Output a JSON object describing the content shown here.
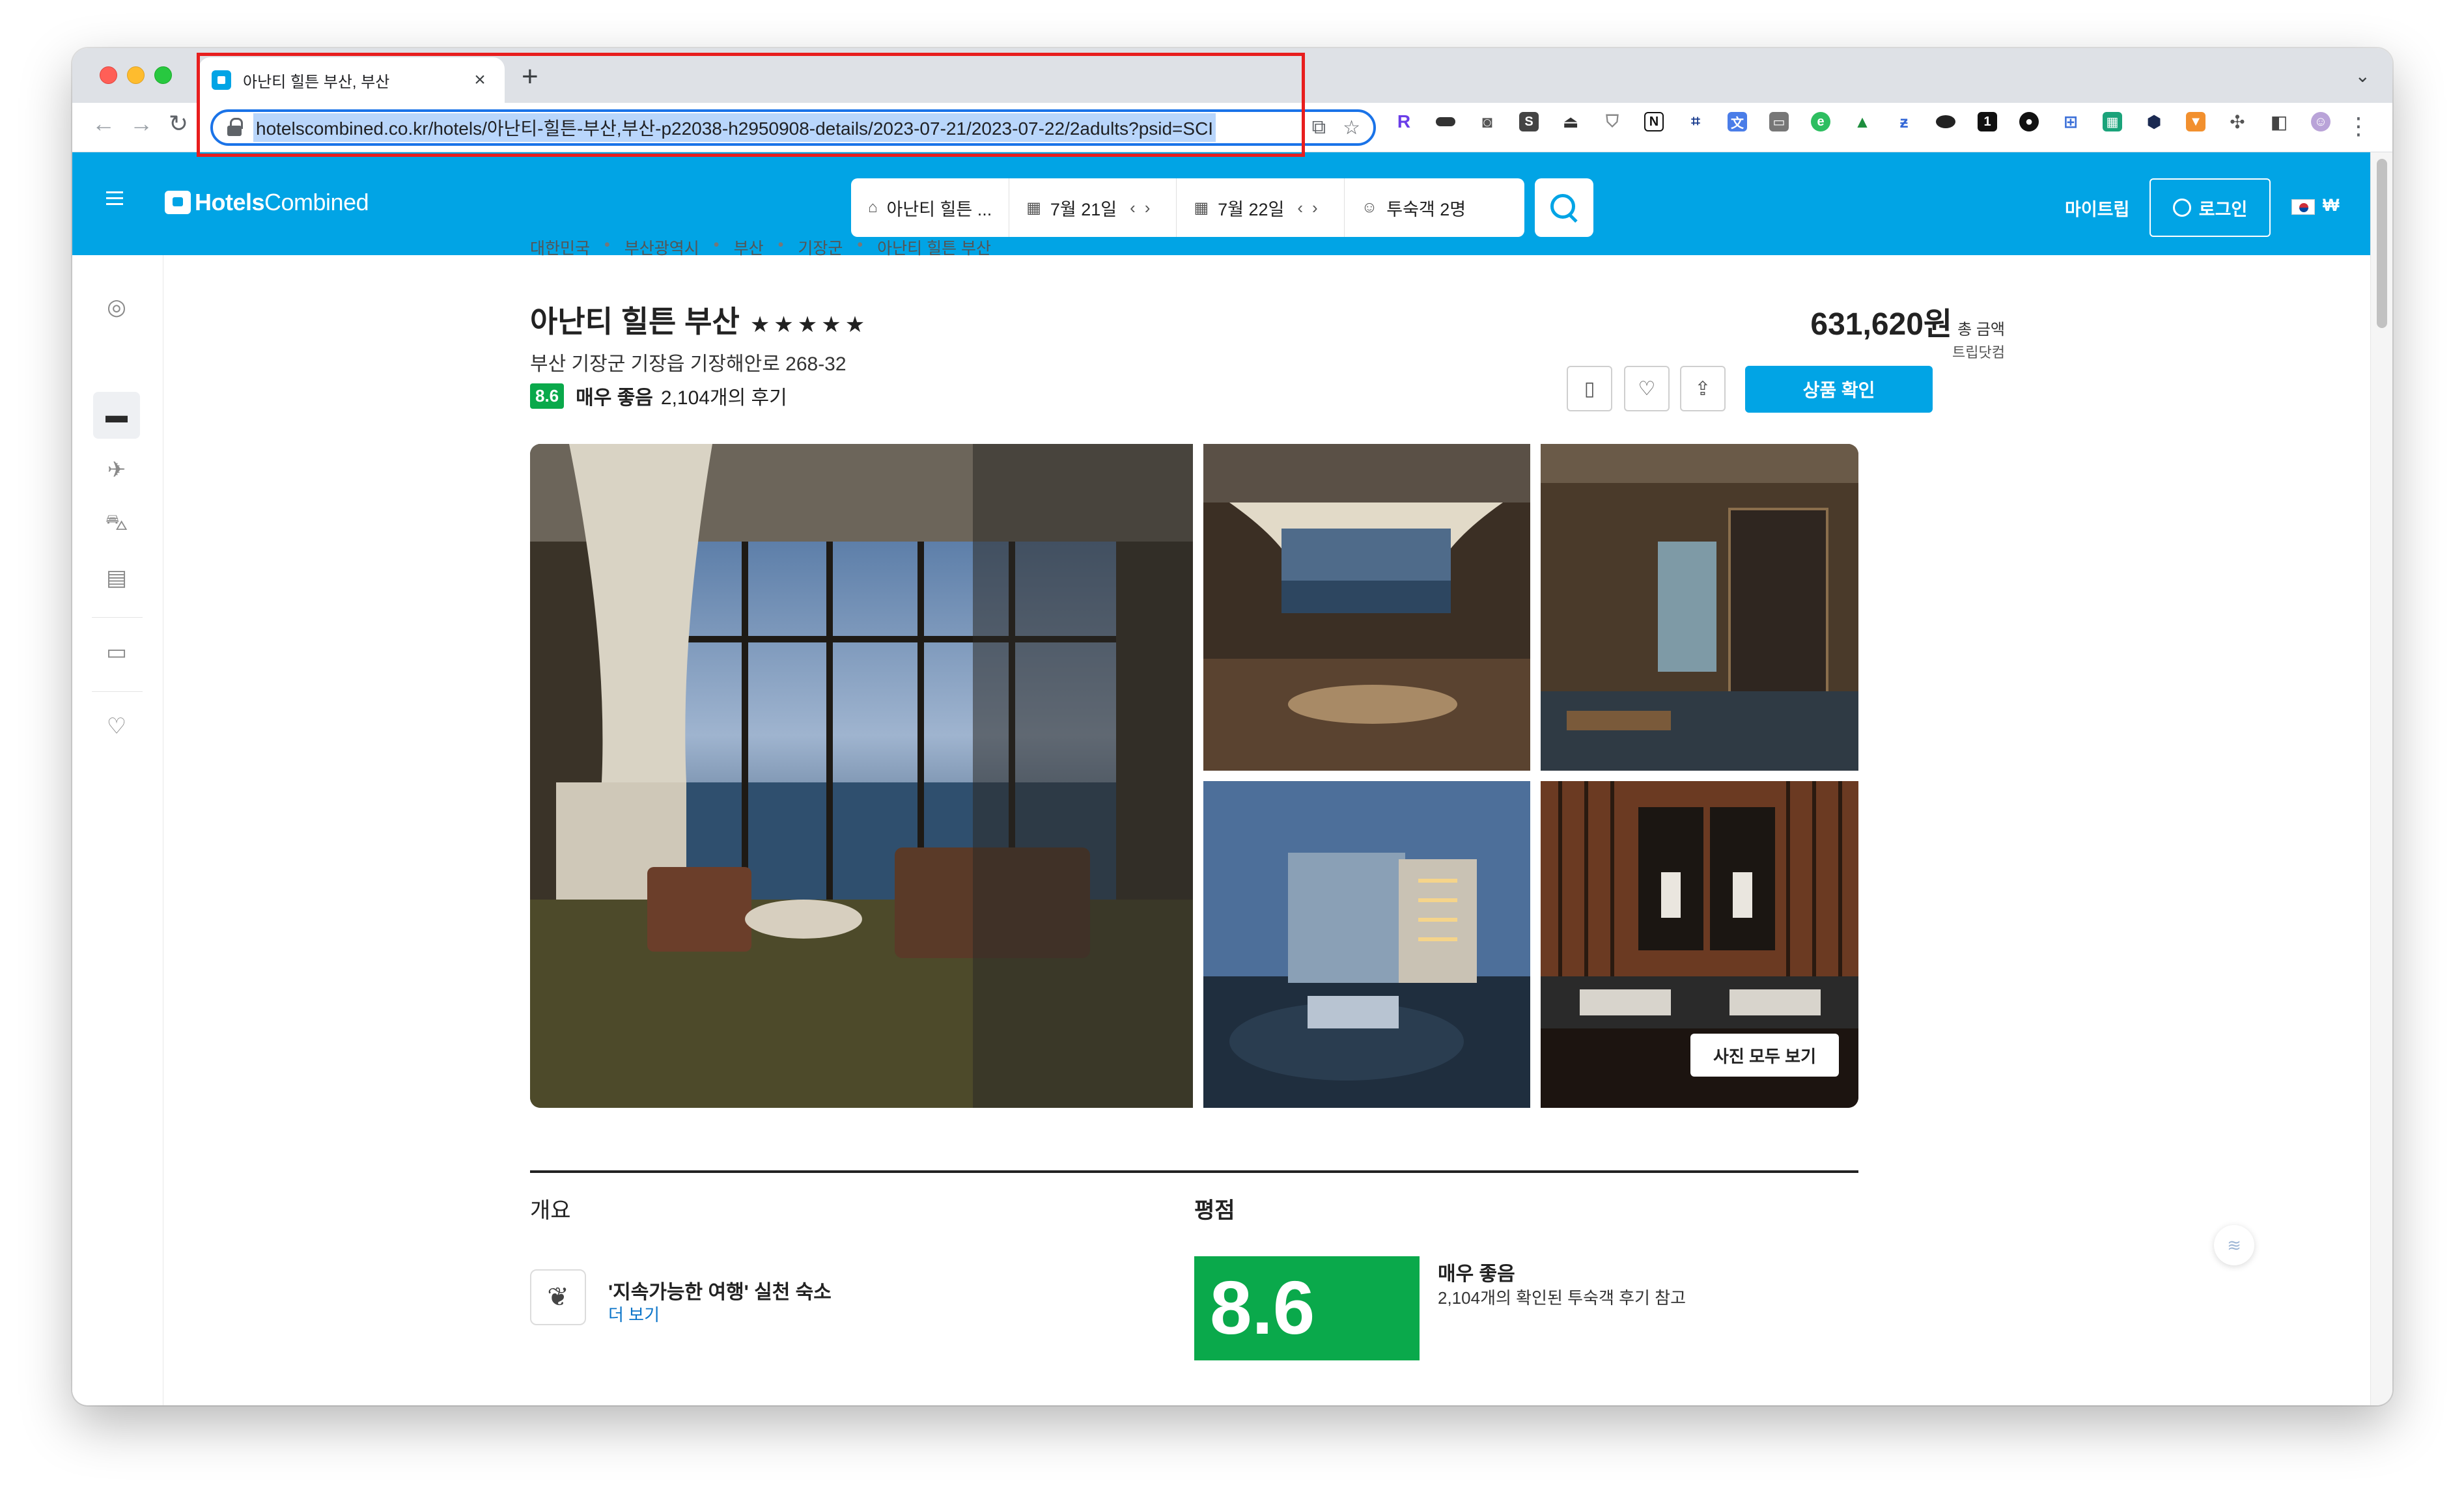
{
  "browser": {
    "tab_title": "아난티 힐튼 부산, 부산",
    "tab_close": "×",
    "new_tab": "+",
    "url": "hotelscombined.co.kr/hotels/아난티-힐튼-부산,부산-p22038-h2950908-details/2023-07-21/2023-07-22/2adults?psid=SCI"
  },
  "header": {
    "logo_bold": "Hotels",
    "logo_regular": "Combined",
    "search": {
      "destination": "아난티 힐튼 ...",
      "checkin": "7월 21일",
      "checkout": "7월 22일",
      "guests": "투숙객 2명"
    },
    "mytrip": "마이트립",
    "login": "로그인",
    "currency": "₩"
  },
  "breadcrumb": [
    "대한민국",
    "부산광역시",
    "부산",
    "기장군",
    "아난티 힐튼 부산"
  ],
  "hotel": {
    "name": "아난티 힐튼 부산",
    "stars": "★★★★★",
    "address": "부산 기장군 기장읍 기장해안로 268-32",
    "score": "8.6",
    "rating_label": "매우 좋음",
    "reviews": "2,104개의 후기"
  },
  "price": {
    "amount": "631,620원",
    "label": "총 금액",
    "provider": "트립닷컴",
    "check_button": "상품 확인"
  },
  "gallery": {
    "all_photos": "사진 모두 보기"
  },
  "sections": {
    "overview": "개요",
    "rating": "평점",
    "eco_title": "'지속가능한 여행' 실천 숙소",
    "eco_more": "더 보기",
    "big_score": "8.6",
    "big_label": "매우 좋음",
    "big_sub": "2,104개의 확인된 투숙객 후기 참고"
  },
  "colors": {
    "brand": "#01a4e5",
    "score_green": "#0aa94b",
    "highlight_red": "#e81e1e"
  }
}
